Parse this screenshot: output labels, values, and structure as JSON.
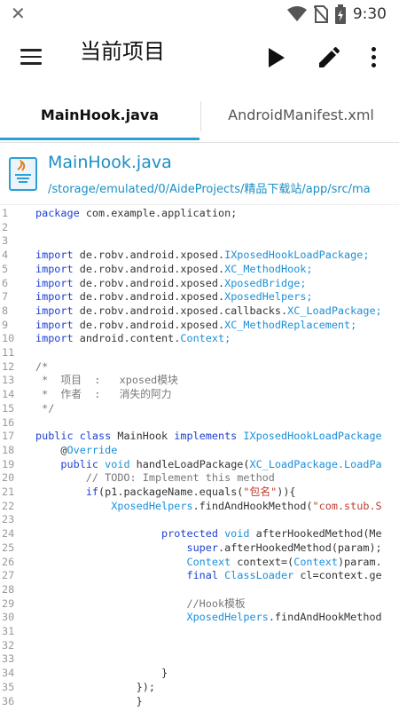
{
  "status_bar": {
    "time": "9:30",
    "icons": [
      "close-icon",
      "wifi-icon",
      "no-sim-icon",
      "battery-charging-icon"
    ]
  },
  "toolbar": {
    "title": "当前项目",
    "actions": [
      "menu-icon",
      "play-icon",
      "edit-icon",
      "more-vertical-icon"
    ]
  },
  "tabs": [
    {
      "label": "MainHook.java",
      "active": true
    },
    {
      "label": "AndroidManifest.xml",
      "active": false
    }
  ],
  "file": {
    "name": "MainHook.java",
    "path": "/storage/emulated/0/AideProjects/精品下载站/app/src/ma",
    "icon": "java-file-icon"
  },
  "colors": {
    "accent": "#2aa0d6",
    "keyword": "#1e3fd1",
    "type": "#1a8fd9",
    "string": "#c0392b",
    "comment": "#777777"
  },
  "code_lines": [
    {
      "n": "1",
      "tokens": [
        {
          "t": "package",
          "c": "kw"
        },
        {
          "t": " com.example.application;",
          "c": "src"
        }
      ]
    },
    {
      "n": "2",
      "tokens": []
    },
    {
      "n": "3",
      "tokens": []
    },
    {
      "n": "4",
      "tokens": [
        {
          "t": "import",
          "c": "kw"
        },
        {
          "t": " de.robv.android.xposed.",
          "c": "src"
        },
        {
          "t": "IXposedHookLoadPackage;",
          "c": "ty"
        }
      ]
    },
    {
      "n": "5",
      "tokens": [
        {
          "t": "import",
          "c": "kw"
        },
        {
          "t": " de.robv.android.xposed.",
          "c": "src"
        },
        {
          "t": "XC_MethodHook;",
          "c": "ty"
        }
      ]
    },
    {
      "n": "6",
      "tokens": [
        {
          "t": "import",
          "c": "kw"
        },
        {
          "t": " de.robv.android.xposed.",
          "c": "src"
        },
        {
          "t": "XposedBridge;",
          "c": "ty"
        }
      ]
    },
    {
      "n": "7",
      "tokens": [
        {
          "t": "import",
          "c": "kw"
        },
        {
          "t": " de.robv.android.xposed.",
          "c": "src"
        },
        {
          "t": "XposedHelpers;",
          "c": "ty"
        }
      ]
    },
    {
      "n": "8",
      "tokens": [
        {
          "t": "import",
          "c": "kw"
        },
        {
          "t": " de.robv.android.xposed.callbacks.",
          "c": "src"
        },
        {
          "t": "XC_LoadPackage;",
          "c": "ty"
        }
      ]
    },
    {
      "n": "9",
      "tokens": [
        {
          "t": "import",
          "c": "kw"
        },
        {
          "t": " de.robv.android.xposed.",
          "c": "src"
        },
        {
          "t": "XC_MethodReplacement;",
          "c": "ty"
        }
      ]
    },
    {
      "n": "10",
      "tokens": [
        {
          "t": "import",
          "c": "kw"
        },
        {
          "t": " android.content.",
          "c": "src"
        },
        {
          "t": "Context;",
          "c": "ty"
        }
      ]
    },
    {
      "n": "11",
      "tokens": []
    },
    {
      "n": "12",
      "tokens": [
        {
          "t": "/*",
          "c": "cm"
        }
      ]
    },
    {
      "n": "13",
      "tokens": [
        {
          "t": " *  项目  :   xposed模块",
          "c": "cm"
        }
      ]
    },
    {
      "n": "14",
      "tokens": [
        {
          "t": " *  作者  :   消失的阿力",
          "c": "cm"
        }
      ]
    },
    {
      "n": "15",
      "tokens": [
        {
          "t": " */",
          "c": "cm"
        }
      ]
    },
    {
      "n": "16",
      "tokens": []
    },
    {
      "n": "17",
      "tokens": [
        {
          "t": "public class",
          "c": "kw"
        },
        {
          "t": " MainHook ",
          "c": "src"
        },
        {
          "t": "implements",
          "c": "kw"
        },
        {
          "t": " IXposedHookLoadPackage",
          "c": "ty"
        }
      ]
    },
    {
      "n": "18",
      "tokens": [
        {
          "t": "    @",
          "c": "src"
        },
        {
          "t": "Override",
          "c": "ty"
        }
      ]
    },
    {
      "n": "19",
      "tokens": [
        {
          "t": "    ",
          "c": "src"
        },
        {
          "t": "public",
          "c": "kw"
        },
        {
          "t": " void ",
          "c": "ty"
        },
        {
          "t": "handleLoadPackage(",
          "c": "src"
        },
        {
          "t": "XC_LoadPackage.LoadPa",
          "c": "ty"
        }
      ]
    },
    {
      "n": "20",
      "tokens": [
        {
          "t": "        // TODO: Implement this method",
          "c": "cm"
        }
      ]
    },
    {
      "n": "21",
      "tokens": [
        {
          "t": "        ",
          "c": "src"
        },
        {
          "t": "if",
          "c": "kw"
        },
        {
          "t": "(p1.packageName.equals(",
          "c": "src"
        },
        {
          "t": "\"包名\"",
          "c": "str"
        },
        {
          "t": ")){",
          "c": "src"
        }
      ]
    },
    {
      "n": "22",
      "tokens": [
        {
          "t": "            ",
          "c": "src"
        },
        {
          "t": "XposedHelpers",
          "c": "ty"
        },
        {
          "t": ".findAndHookMethod(",
          "c": "src"
        },
        {
          "t": "\"com.stub.S",
          "c": "str"
        }
      ]
    },
    {
      "n": "23",
      "tokens": []
    },
    {
      "n": "24",
      "tokens": [
        {
          "t": "                    ",
          "c": "src"
        },
        {
          "t": "protected",
          "c": "kw"
        },
        {
          "t": " void ",
          "c": "ty"
        },
        {
          "t": "afterHookedMethod(Me",
          "c": "src"
        }
      ]
    },
    {
      "n": "25",
      "tokens": [
        {
          "t": "                        ",
          "c": "src"
        },
        {
          "t": "super",
          "c": "kw"
        },
        {
          "t": ".afterHookedMethod(param);",
          "c": "src"
        }
      ]
    },
    {
      "n": "26",
      "tokens": [
        {
          "t": "                        ",
          "c": "src"
        },
        {
          "t": "Context",
          "c": "ty"
        },
        {
          "t": " context=(",
          "c": "src"
        },
        {
          "t": "Context",
          "c": "ty"
        },
        {
          "t": ")param.",
          "c": "src"
        }
      ]
    },
    {
      "n": "27",
      "tokens": [
        {
          "t": "                        ",
          "c": "src"
        },
        {
          "t": "final",
          "c": "kw"
        },
        {
          "t": " ClassLoader",
          "c": "ty"
        },
        {
          "t": " cl=context.ge",
          "c": "src"
        }
      ]
    },
    {
      "n": "28",
      "tokens": []
    },
    {
      "n": "29",
      "tokens": [
        {
          "t": "                        //Hook模板",
          "c": "cm"
        }
      ]
    },
    {
      "n": "30",
      "tokens": [
        {
          "t": "                        ",
          "c": "src"
        },
        {
          "t": "XposedHelpers",
          "c": "ty"
        },
        {
          "t": ".findAndHookMethod",
          "c": "src"
        }
      ]
    },
    {
      "n": "31",
      "tokens": []
    },
    {
      "n": "32",
      "tokens": []
    },
    {
      "n": "33",
      "tokens": []
    },
    {
      "n": "34",
      "tokens": [
        {
          "t": "                    }",
          "c": "src"
        }
      ]
    },
    {
      "n": "35",
      "tokens": [
        {
          "t": "                });",
          "c": "src"
        }
      ]
    },
    {
      "n": "36",
      "tokens": [
        {
          "t": "                }",
          "c": "src"
        }
      ]
    }
  ]
}
